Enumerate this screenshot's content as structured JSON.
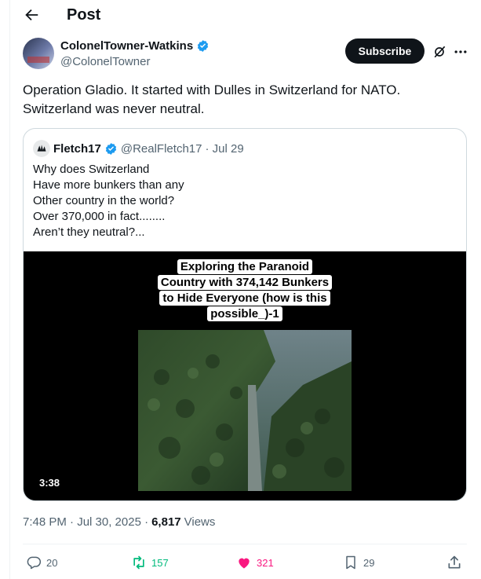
{
  "header": {
    "title": "Post"
  },
  "author": {
    "name": "ColonelTowner-Watkins",
    "handle": "@ColonelTowner"
  },
  "subscribe_label": "Subscribe",
  "post_text": [
    "Operation Gladio. It started with Dulles in Switzerland for NATO.",
    "Switzerland was never neutral."
  ],
  "quote": {
    "name": "Fletch17",
    "handle": "@RealFletch17",
    "date": "· Jul 29",
    "lines": [
      "Why does Switzerland",
      "Have more bunkers than any",
      "Other country in the world?",
      "Over 370,000 in fact........",
      "Aren’t they neutral?..."
    ],
    "video": {
      "caption_lines": [
        "Exploring the Paranoid",
        "Country with 374,142 Bunkers",
        "to Hide Everyone (how is this",
        "possible_)-1"
      ],
      "duration": "3:38"
    }
  },
  "meta": {
    "time": "7:48 PM · Jul 30, 2025 ·",
    "views_count": "6,817",
    "views_label": "Views"
  },
  "actions": {
    "replies": "20",
    "reposts": "157",
    "likes": "321",
    "bookmarks": "29"
  },
  "colors": {
    "verified": "#1d9bf0",
    "repost": "#00ba7c",
    "like": "#f91880"
  }
}
